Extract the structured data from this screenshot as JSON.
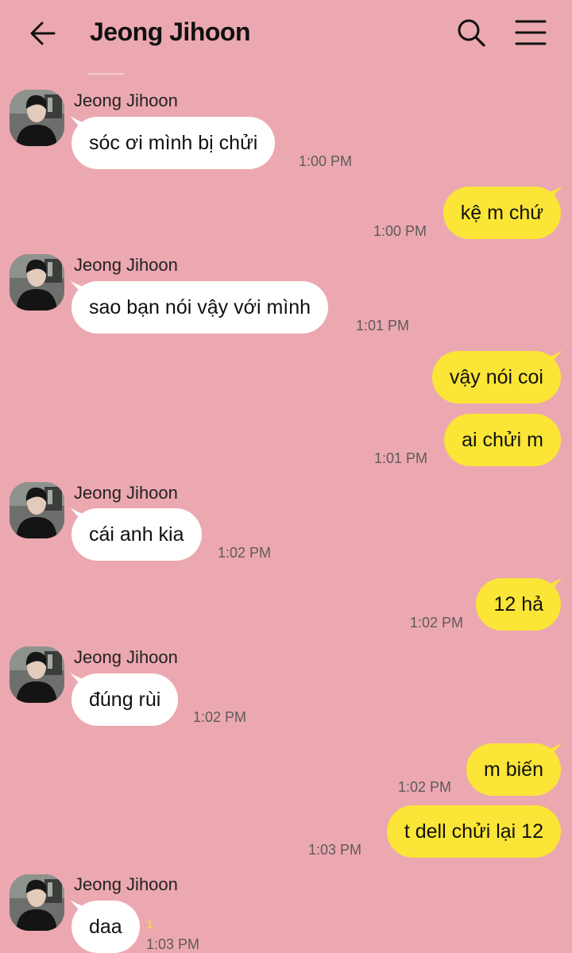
{
  "header": {
    "title": "Jeong Jihoon",
    "icons": [
      "back-arrow-icon",
      "search-icon",
      "menu-icon"
    ]
  },
  "contact": {
    "name": "Jeong Jihoon"
  },
  "colors": {
    "background": "#eca8b0",
    "incoming_bubble": "#ffffff",
    "outgoing_bubble": "#fbe536",
    "unread_count": "#f2d84a"
  },
  "messages": [
    {
      "direction": "in",
      "text": "sóc ơi mình bị chửi",
      "time": "1:00 PM"
    },
    {
      "direction": "out",
      "text": "kệ m chứ",
      "time": "1:00 PM"
    },
    {
      "direction": "in",
      "text": "sao bạn nói vậy với mình",
      "time": "1:01 PM"
    },
    {
      "direction": "out",
      "text": "vậy nói coi",
      "time": ""
    },
    {
      "direction": "out",
      "text": "ai chửi m",
      "time": "1:01 PM"
    },
    {
      "direction": "in",
      "text": "cái anh kia",
      "time": "1:02 PM"
    },
    {
      "direction": "out",
      "text": "12 hả",
      "time": "1:02 PM"
    },
    {
      "direction": "in",
      "text": "đúng rùi",
      "time": "1:02 PM"
    },
    {
      "direction": "out",
      "text": "m biến",
      "time": "1:02 PM"
    },
    {
      "direction": "out",
      "text": "t dell chửi lại 12",
      "time": "1:03 PM"
    },
    {
      "direction": "in",
      "text": "daa",
      "time": "1:03 PM",
      "unread": "1"
    }
  ]
}
